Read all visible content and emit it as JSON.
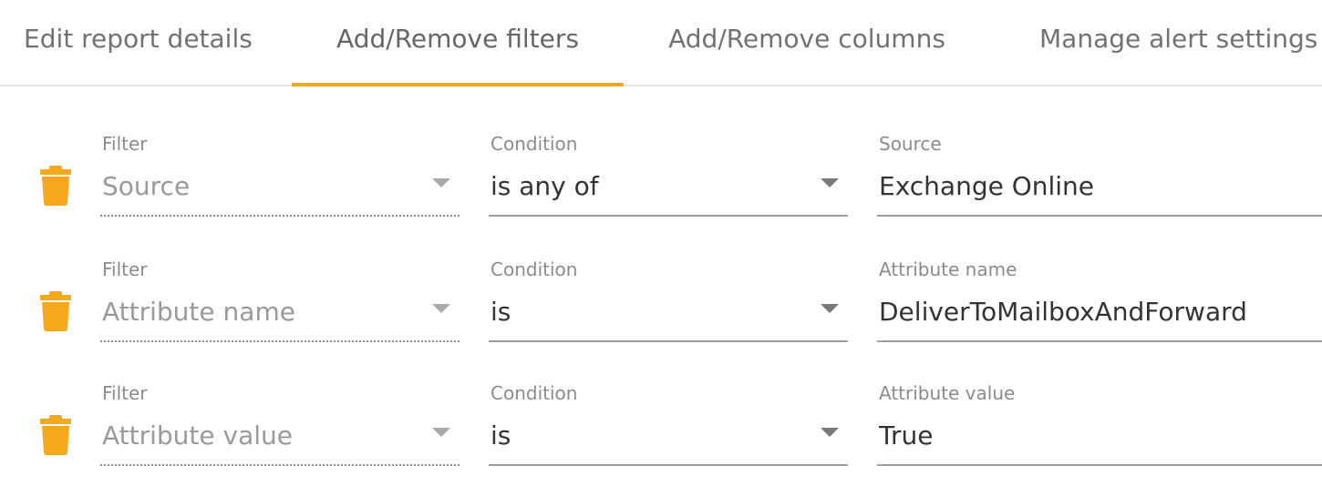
{
  "tabs": [
    {
      "label": "Edit report details",
      "active": false
    },
    {
      "label": "Add/Remove filters",
      "active": true
    },
    {
      "label": "Add/Remove columns",
      "active": false
    },
    {
      "label": "Manage alert settings",
      "active": false
    }
  ],
  "colors": {
    "accent": "#f5a81c",
    "trash_icon": "#f5a81c"
  },
  "filters": [
    {
      "icon": "trash-icon",
      "filter_label": "Filter",
      "filter_value": "Source",
      "condition_label": "Condition",
      "condition_value": "is any of",
      "value_label": "Source",
      "value": "Exchange Online"
    },
    {
      "icon": "trash-icon",
      "filter_label": "Filter",
      "filter_value": "Attribute name",
      "condition_label": "Condition",
      "condition_value": "is",
      "value_label": "Attribute name",
      "value": "DeliverToMailboxAndForward"
    },
    {
      "icon": "trash-icon",
      "filter_label": "Filter",
      "filter_value": "Attribute value",
      "condition_label": "Condition",
      "condition_value": "is",
      "value_label": "Attribute value",
      "value": "True"
    }
  ]
}
